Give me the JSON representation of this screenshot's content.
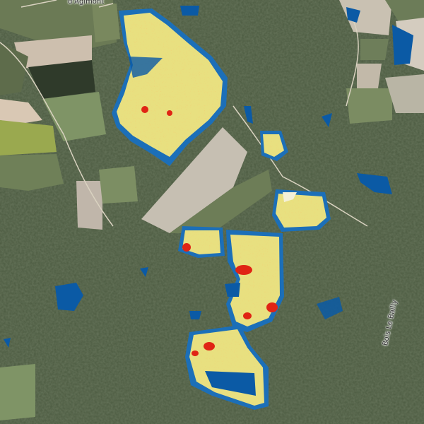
{
  "map": {
    "labels": {
      "top_place": "d'Agimont",
      "road": "Bois Le Bailly"
    },
    "colors": {
      "forest": "#4b5a40",
      "forest_light": "#5f6e4e",
      "field_pale": "#c6bfb2",
      "field_green": "#7f9466",
      "field_dark": "#3a4530",
      "index_blue": "#0a5aa8",
      "index_cyan": "#7cc8d8",
      "index_yellow": "#f6e27a",
      "index_orange": "#f2a03a",
      "index_red": "#e02414"
    },
    "layer": {
      "type": "vegetation-index raster overlay",
      "ramp": [
        "blue",
        "cyan",
        "yellow",
        "orange",
        "red"
      ]
    }
  }
}
